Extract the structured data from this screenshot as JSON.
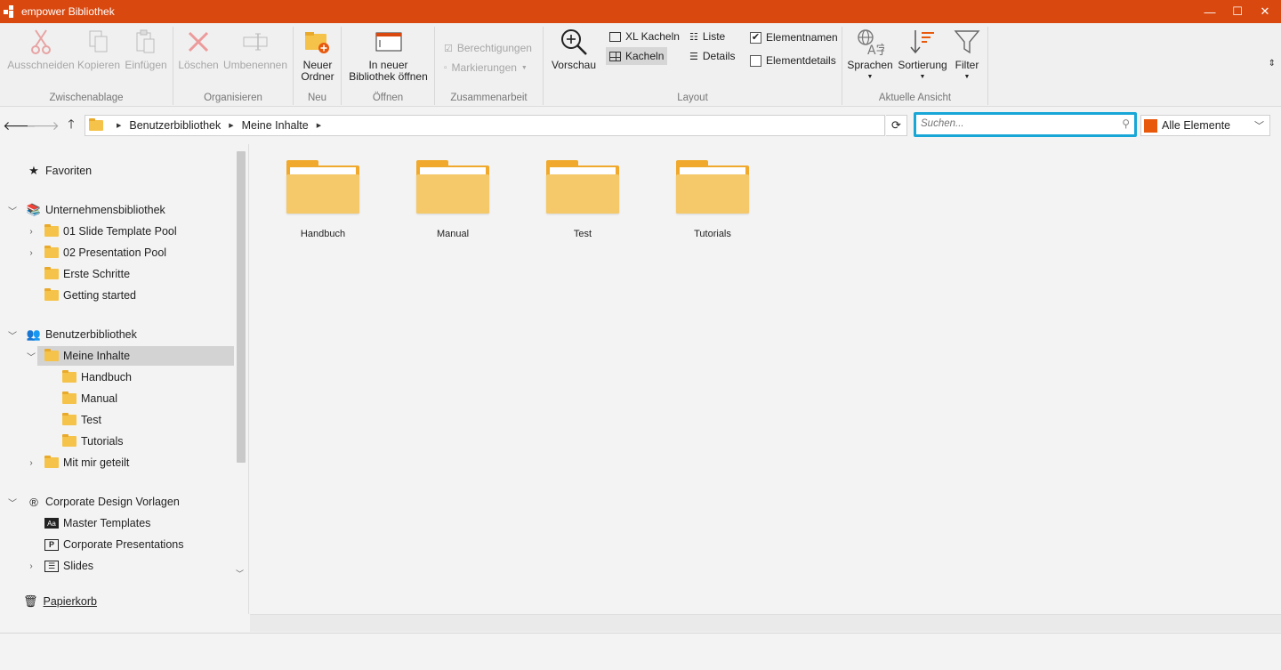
{
  "window": {
    "title": "empower Bibliothek",
    "minimize": "—",
    "maximize": "☐",
    "close": "✕"
  },
  "ribbon": {
    "groups": {
      "clipboard": "Zwischenablage",
      "organize": "Organisieren",
      "new": "Neu",
      "open": "Öffnen",
      "collaboration": "Zusammenarbeit",
      "layout": "Layout",
      "current_view": "Aktuelle Ansicht"
    },
    "cut": "Ausschneiden",
    "copy": "Kopieren",
    "paste": "Einfügen",
    "delete": "Löschen",
    "rename": "Umbenennen",
    "new_folder_1": "Neuer",
    "new_folder_2": "Ordner",
    "open_new_1": "In neuer",
    "open_new_2": "Bibliothek öffnen",
    "permissions": "Berechtigungen",
    "tags": "Markierungen",
    "preview": "Vorschau",
    "xl_tiles": "XL Kacheln",
    "tiles": "Kacheln",
    "list": "Liste",
    "details": "Details",
    "element_names": "Elementnamen",
    "element_details": "Elementdetails",
    "element_names_checked": true,
    "element_details_checked": false,
    "languages": "Sprachen",
    "sorting": "Sortierung",
    "filter": "Filter"
  },
  "navigation": {
    "breadcrumb": [
      "Benutzerbibliothek",
      "Meine Inhalte"
    ],
    "search_placeholder": "Suchen...",
    "filter_value": "Alle Elemente"
  },
  "sidebar": {
    "favorites": "Favoriten",
    "company_library": "Unternehmensbibliothek",
    "company_items": [
      "01 Slide Template Pool",
      "02 Presentation Pool",
      "Erste Schritte",
      "Getting started"
    ],
    "user_library": "Benutzerbibliothek",
    "my_content": "Meine Inhalte",
    "my_content_items": [
      "Handbuch",
      "Manual",
      "Test",
      "Tutorials"
    ],
    "shared_with_me": "Mit mir geteilt",
    "corporate_design": "Corporate Design Vorlagen",
    "corporate_items": [
      "Master Templates",
      "Corporate Presentations",
      "Slides"
    ],
    "recycle_bin": "Papierkorb"
  },
  "content": {
    "folders": [
      "Handbuch",
      "Manual",
      "Test",
      "Tutorials"
    ]
  },
  "colors": {
    "titlebar": "#d9480f",
    "search_border": "#17a6d6",
    "folder": "#f5c96a",
    "selection": "#d3d3d3"
  }
}
